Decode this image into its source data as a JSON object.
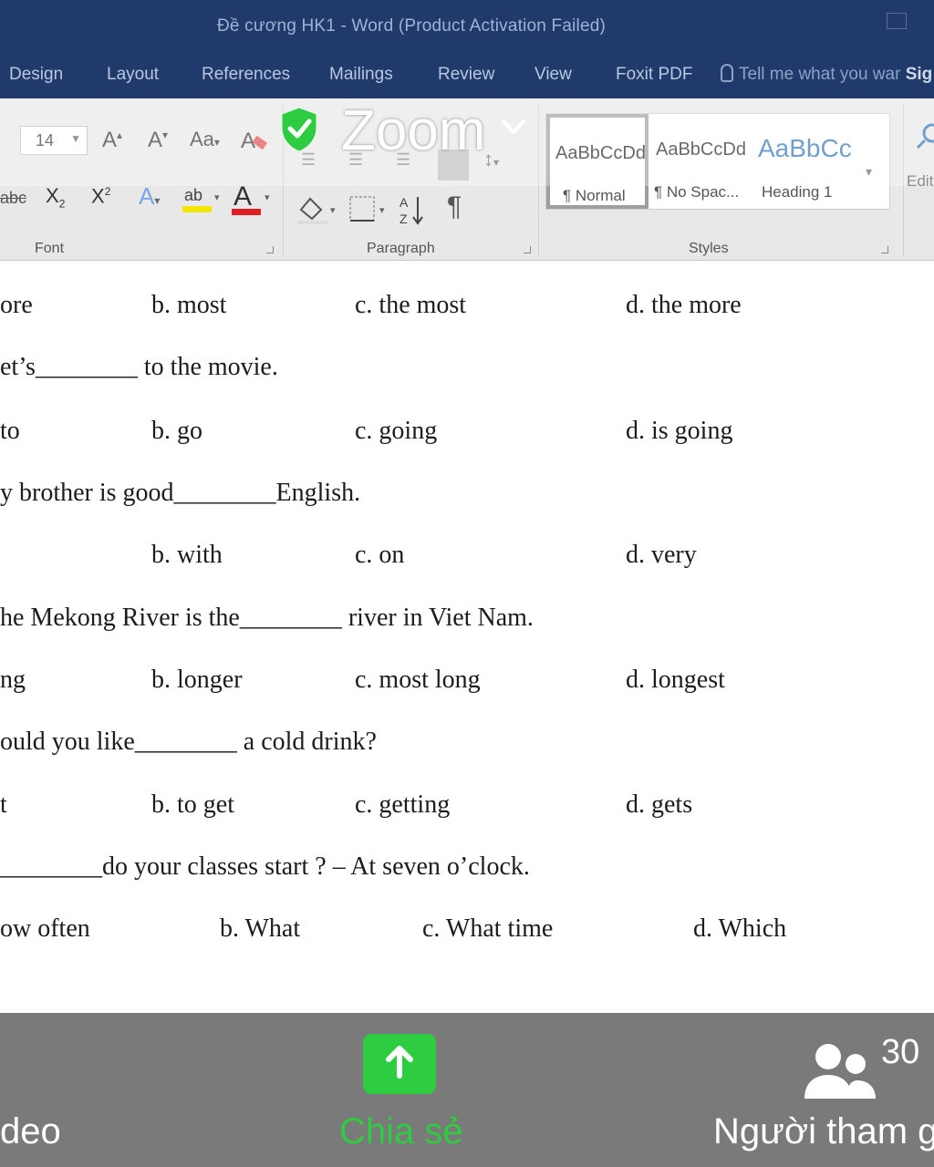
{
  "window": {
    "title": "Đề cương HK1 - Word (Product Activation Failed)"
  },
  "menu": {
    "tabs": [
      "Design",
      "Layout",
      "References",
      "Mailings",
      "Review",
      "View",
      "Foxit PDF"
    ],
    "tell_me": "Tell me what you war",
    "sign_in": "Sig"
  },
  "ribbon": {
    "font_size": "14",
    "groups": {
      "font": "Font",
      "paragraph": "Paragraph",
      "styles": "Styles"
    },
    "edit_label": "Edit",
    "styles": [
      {
        "sample": "AaBbCcDd",
        "name": "¶ Normal"
      },
      {
        "sample": "AaBbCcDd",
        "name": "¶ No Spac..."
      },
      {
        "sample": "AaBbCc",
        "name": "Heading 1"
      }
    ]
  },
  "zoom": {
    "label": "Zoom",
    "shield_color": "#2ecc40"
  },
  "document": {
    "lines": [
      [
        "ore",
        "b. most",
        "c. the most",
        "d. the more"
      ],
      [
        "et’s________ to the movie."
      ],
      [
        " to",
        "b. go",
        "c. going",
        "d. is going"
      ],
      [
        "y brother is good________English."
      ],
      [
        "b. with",
        "c. on",
        "d. very"
      ],
      [
        "he Mekong River is the________ river in Viet Nam."
      ],
      [
        "ng",
        "b. longer",
        "c. most long",
        "d. longest"
      ],
      [
        "ould you like________ a cold drink?"
      ],
      [
        "t",
        "b. to get",
        "c. getting",
        "d. gets"
      ],
      [
        "________do your classes start ? – At seven o’clock."
      ],
      [
        "ow often",
        "b. What",
        "c. What time",
        "d. Which"
      ]
    ]
  },
  "bottom_bar": {
    "video_label": "deo",
    "share_label": "Chia sẻ",
    "participants_label": "Người tham g",
    "participants_count": "30",
    "share_color": "#2ecc40"
  }
}
